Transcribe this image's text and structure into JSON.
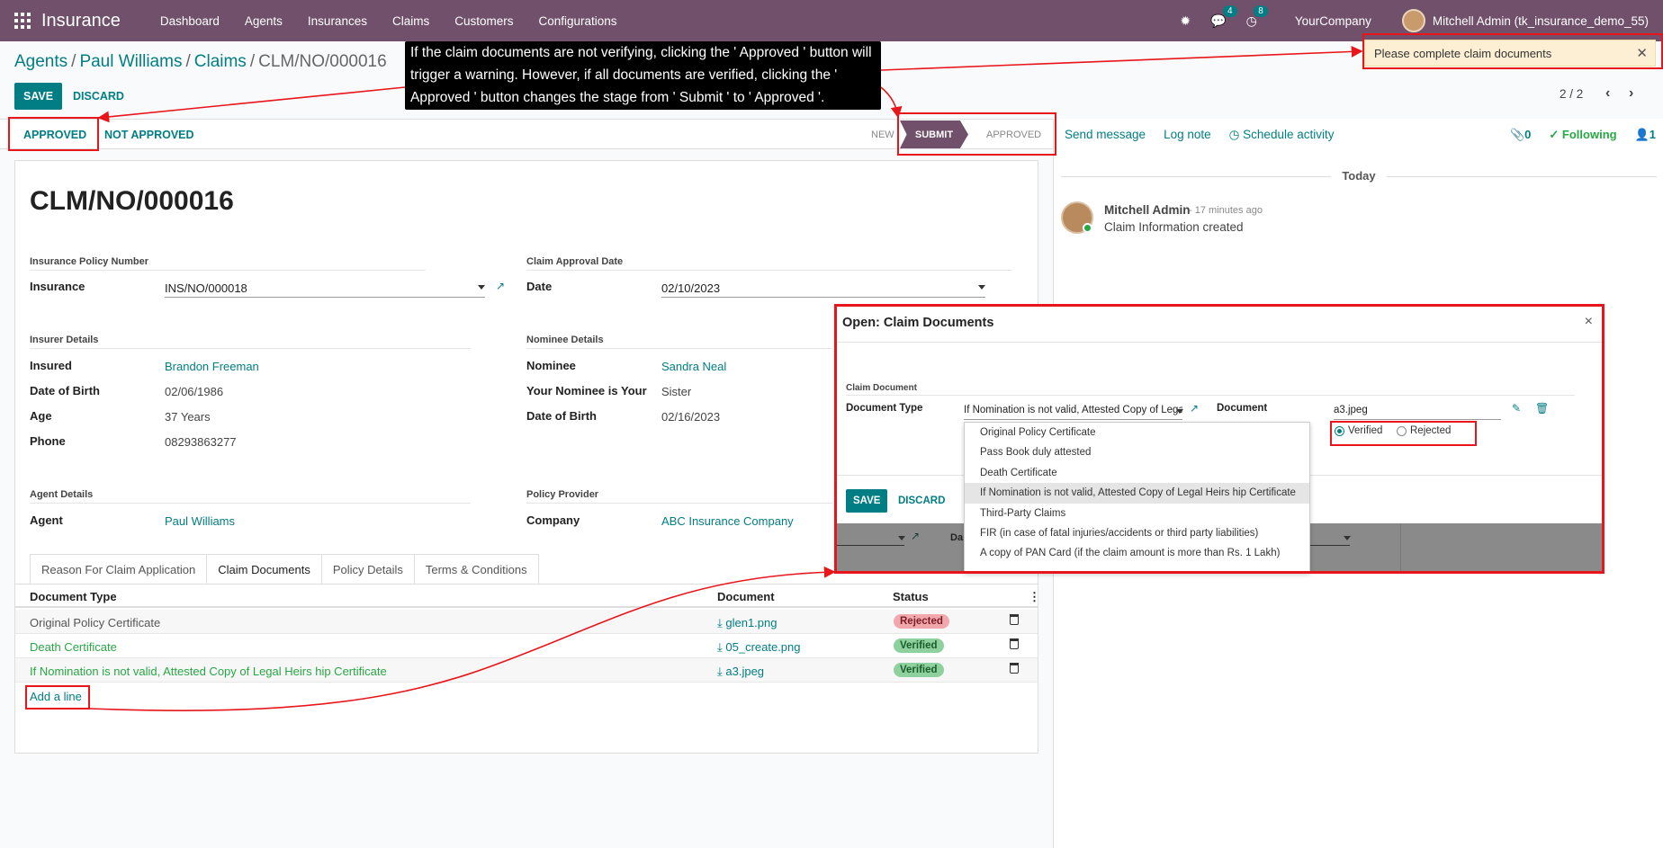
{
  "navbar": {
    "app_name": "Insurance",
    "menu": [
      "Dashboard",
      "Agents",
      "Insurances",
      "Claims",
      "Customers",
      "Configurations"
    ],
    "messages_badge": "4",
    "activities_badge": "8",
    "company": "YourCompany",
    "user": "Mitchell Admin (tk_insurance_demo_55)"
  },
  "breadcrumb": {
    "items": [
      "Agents",
      "Paul Williams",
      "Claims"
    ],
    "current": "CLM/NO/000016"
  },
  "control": {
    "save_label": "SAVE",
    "discard_label": "DISCARD",
    "pager": "2 / 2"
  },
  "statusbar": {
    "approved_btn": "APPROVED",
    "not_approved_btn": "NOT APPROVED",
    "stages": [
      "NEW",
      "SUBMIT",
      "APPROVED"
    ],
    "active_stage": "SUBMIT"
  },
  "form": {
    "title": "CLM/NO/000016",
    "policy_section": "Insurance Policy Number",
    "insurance_label": "Insurance",
    "insurance_value": "INS/NO/000018",
    "approval_section": "Claim Approval Date",
    "date_label": "Date",
    "date_value": "02/10/2023",
    "insurer_section": "Insurer Details",
    "insured_label": "Insured",
    "insured_value": "Brandon Freeman",
    "dob_label": "Date of Birth",
    "dob_value": "02/06/1986",
    "age_label": "Age",
    "age_value": "37 Years",
    "phone_label": "Phone",
    "phone_value": "08293863277",
    "nominee_section": "Nominee Details",
    "nominee_label": "Nominee",
    "nominee_value": "Sandra Neal",
    "relation_label": "Your Nominee is Your",
    "relation_value": "Sister",
    "nominee_dob_label": "Date of Birth",
    "nominee_dob_value": "02/16/2023",
    "agent_section": "Agent Details",
    "agent_label": "Agent",
    "agent_value": "Paul Williams",
    "provider_section": "Policy Provider",
    "company_label": "Company",
    "company_value": "ABC Insurance Company"
  },
  "tabs": [
    "Reason For Claim Application",
    "Claim Documents",
    "Policy Details",
    "Terms & Conditions"
  ],
  "table": {
    "headers": [
      "Document Type",
      "Document",
      "Status"
    ],
    "rows": [
      {
        "type": "Original Policy Certificate",
        "document": "glen1.png",
        "status": "Rejected"
      },
      {
        "type": "Death Certificate",
        "document": "05_create.png",
        "status": "Verified"
      },
      {
        "type": "If Nomination is not valid, Attested Copy of Legal Heirs hip Certificate",
        "document": "a3.jpeg",
        "status": "Verified"
      }
    ],
    "add_line": "Add a line"
  },
  "chatter": {
    "send_message": "Send message",
    "log_note": "Log note",
    "schedule": "Schedule activity",
    "attachments": "0",
    "following": "Following",
    "followers": "1",
    "today": "Today",
    "author": "Mitchell Admin",
    "time": "- 17 minutes ago",
    "body": "Claim Information created"
  },
  "notification": {
    "text": "Please complete claim documents"
  },
  "tooltip": {
    "text": "If the claim documents are not verifying, clicking the ' Approved ' button will trigger a warning. However, if all documents are verified, clicking the ' Approved ' button changes the stage from ' Submit ' to ' Approved '."
  },
  "dialog": {
    "title": "Open: Claim Documents",
    "section": "Claim Document",
    "doc_type_label": "Document Type",
    "doc_type_value": "If Nomination is not valid, Attested Copy of Legal Heirs hip Certificate",
    "document_label": "Document",
    "document_value": "a3.jpeg",
    "radio_verified": "Verified",
    "radio_rejected": "Rejected",
    "selected_status": "Verified",
    "save_label": "SAVE",
    "discard_label": "DISCARD",
    "behind_label": "Da",
    "dropdown_options": [
      "Original Policy Certificate",
      "Pass Book duly attested",
      "Death Certificate",
      "If Nomination is not valid, Attested Copy of Legal Heirs hip Certificate",
      "Third-Party Claims",
      "FIR (in case of fatal injuries/accidents or third party liabilities)",
      "A copy of PAN Card (if the claim amount is more than Rs. 1 Lakh)"
    ],
    "highlighted_option": "If Nomination is not valid, Attested Copy of Legal Heirs hip Certificate"
  },
  "colors": {
    "navbar": "#71506b",
    "accent": "#017e84",
    "annotation": "#e8151b",
    "verified": "#8fd19e",
    "rejected": "#f1a8ad"
  }
}
